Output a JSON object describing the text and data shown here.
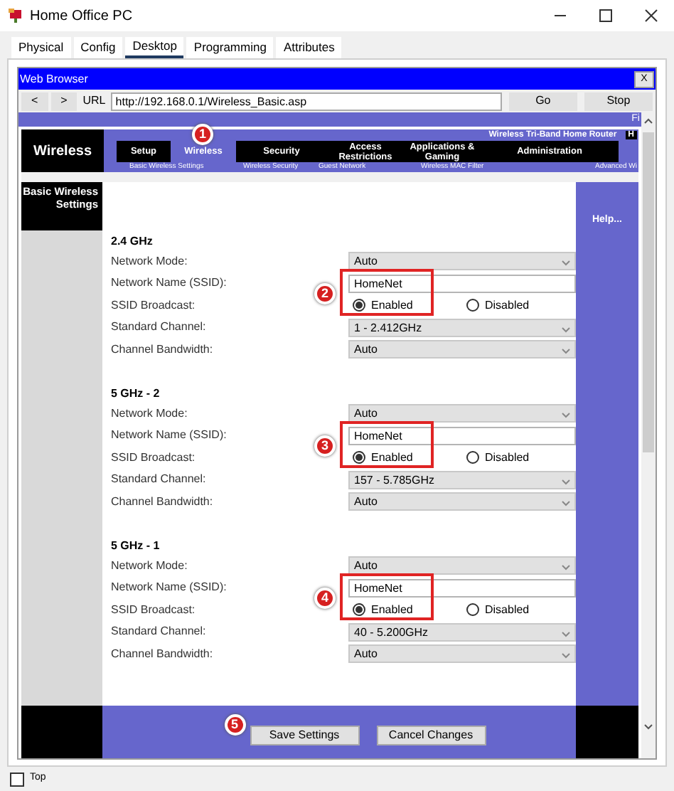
{
  "window": {
    "title": "Home Office PC"
  },
  "tabs": [
    {
      "label": "Physical",
      "selected": false
    },
    {
      "label": "Config",
      "selected": false
    },
    {
      "label": "Desktop",
      "selected": true
    },
    {
      "label": "Programming",
      "selected": false
    },
    {
      "label": "Attributes",
      "selected": false
    }
  ],
  "browser": {
    "title": "Web Browser",
    "close": "X",
    "back": "<",
    "forward": ">",
    "url_label": "URL",
    "url": "http://192.168.0.1/Wireless_Basic.asp",
    "go": "Go",
    "stop": "Stop",
    "top_strip_text": "Fi"
  },
  "router": {
    "section_title": "Wireless",
    "product": "Wireless Tri-Band Home Router",
    "product_cut": "H",
    "nav": [
      {
        "label": "Setup",
        "selected": false
      },
      {
        "label": "Wireless",
        "selected": true,
        "marker": "1"
      },
      {
        "label": "Security",
        "selected": false
      },
      {
        "label": "Access Restrictions",
        "selected": false
      },
      {
        "label": "Applications & Gaming",
        "selected": false
      },
      {
        "label": "Administration",
        "selected": false
      }
    ],
    "subnav": [
      "Basic Wireless Settings",
      "Wireless Security",
      "Guest Network",
      "Wireless MAC Filter",
      "Advanced Wi"
    ],
    "side_title": "Basic Wireless Settings",
    "help": "Help...",
    "sections": [
      {
        "heading": "2.4 GHz",
        "marker": "2",
        "rows": [
          {
            "label": "Network Mode:",
            "kind": "select",
            "value": "Auto"
          },
          {
            "label": "Network Name (SSID):",
            "kind": "text",
            "value": "HomeNet"
          },
          {
            "label": "SSID Broadcast:",
            "kind": "radio",
            "options": [
              {
                "label": "Enabled",
                "selected": true
              },
              {
                "label": "Disabled",
                "selected": false
              }
            ]
          },
          {
            "label": "Standard Channel:",
            "kind": "select",
            "value": "1 - 2.412GHz"
          },
          {
            "label": "Channel Bandwidth:",
            "kind": "select",
            "value": "Auto"
          }
        ]
      },
      {
        "heading": "5 GHz - 2",
        "marker": "3",
        "rows": [
          {
            "label": "Network Mode:",
            "kind": "select",
            "value": "Auto"
          },
          {
            "label": "Network Name (SSID):",
            "kind": "text",
            "value": "HomeNet"
          },
          {
            "label": "SSID Broadcast:",
            "kind": "radio",
            "options": [
              {
                "label": "Enabled",
                "selected": true
              },
              {
                "label": "Disabled",
                "selected": false
              }
            ]
          },
          {
            "label": "Standard Channel:",
            "kind": "select",
            "value": "157 - 5.785GHz"
          },
          {
            "label": "Channel Bandwidth:",
            "kind": "select",
            "value": "Auto"
          }
        ]
      },
      {
        "heading": "5 GHz - 1",
        "marker": "4",
        "rows": [
          {
            "label": "Network Mode:",
            "kind": "select",
            "value": "Auto"
          },
          {
            "label": "Network Name (SSID):",
            "kind": "text",
            "value": "HomeNet"
          },
          {
            "label": "SSID Broadcast:",
            "kind": "radio",
            "options": [
              {
                "label": "Enabled",
                "selected": true
              },
              {
                "label": "Disabled",
                "selected": false
              }
            ]
          },
          {
            "label": "Standard Channel:",
            "kind": "select",
            "value": "40 - 5.200GHz"
          },
          {
            "label": "Channel Bandwidth:",
            "kind": "select",
            "value": "Auto"
          }
        ]
      }
    ],
    "buttons": [
      {
        "label": "Save Settings",
        "marker": "5"
      },
      {
        "label": "Cancel Changes"
      }
    ]
  },
  "top_checkbox": {
    "label": "Top",
    "checked": false
  }
}
